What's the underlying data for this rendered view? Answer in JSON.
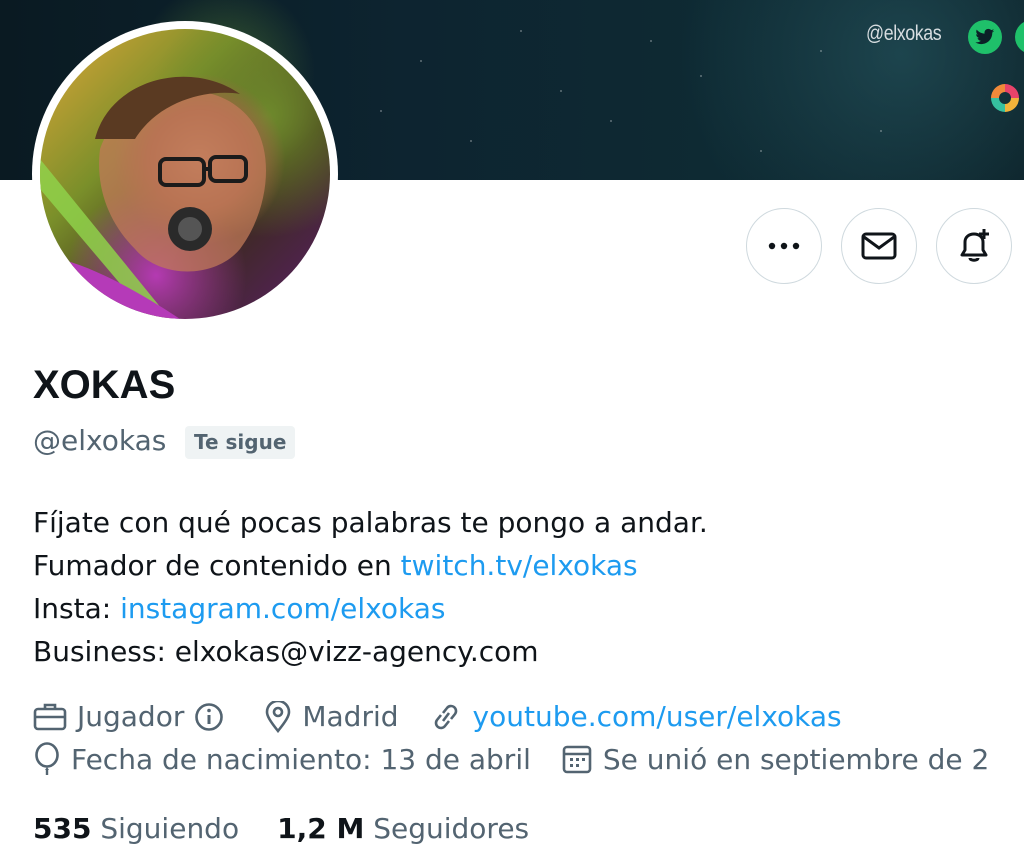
{
  "banner": {
    "handle": "@elxokas",
    "twitter_icon": "twitter-bird-icon",
    "logo_icon": "swirl-logo-icon",
    "accent": "#1fc06a"
  },
  "profile": {
    "display_name": "XOKAS",
    "handle": "@elxokas",
    "follows_you_badge": "Te sigue",
    "avatar": "avatar-portrait"
  },
  "actions": [
    {
      "name": "more-options",
      "icon": "more-dots-icon"
    },
    {
      "name": "message",
      "icon": "envelope-icon"
    },
    {
      "name": "notify",
      "icon": "bell-plus-icon"
    }
  ],
  "bio": {
    "line1": "Fíjate con qué pocas palabras te pongo a andar.",
    "line2_prefix": "Fumador de contenido en ",
    "line2_link": "twitch.tv/elxokas",
    "line3_prefix": "Insta: ",
    "line3_link": "instagram.com/elxokas",
    "line4": "Business: elxokas@vizz-agency.com"
  },
  "meta": {
    "category": "Jugador",
    "location": "Madrid",
    "website": "youtube.com/user/elxokas",
    "birthday": "Fecha de nacimiento: 13 de abril",
    "joined": "Se unió en septiembre de 2"
  },
  "stats": {
    "following_count": "535",
    "following_label": "Siguiendo",
    "followers_count": "1,2 M",
    "followers_label": "Seguidores"
  },
  "colors": {
    "link": "#1d9bf0",
    "secondary_text": "#536471",
    "primary_text": "#0f1419",
    "border": "#cfd9de"
  }
}
